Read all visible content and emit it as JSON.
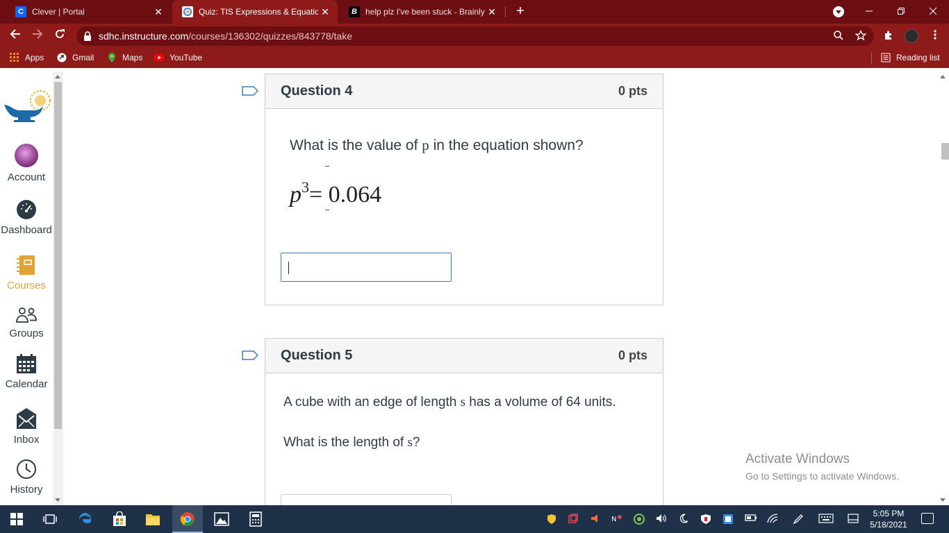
{
  "browser": {
    "tabs": [
      {
        "title": "Clever | Portal",
        "favicon": "clever-icon",
        "active": false
      },
      {
        "title": "Quiz: TIS Expressions & Equations",
        "favicon": "canvas-icon",
        "active": true
      },
      {
        "title": "help plz I've been stuck - Brainly",
        "favicon": "brainly-icon",
        "active": false
      }
    ],
    "close_glyph": "✕",
    "newtab_glyph": "+",
    "url_host": "sdhc.instructure.com",
    "url_path": "/courses/136302/quizzes/843778/take",
    "bookmarks": [
      {
        "label": "Apps",
        "icon": "apps-grid-icon"
      },
      {
        "label": "Gmail",
        "icon": "gmail-icon"
      },
      {
        "label": "Maps",
        "icon": "maps-pin-icon"
      },
      {
        "label": "YouTube",
        "icon": "youtube-icon"
      }
    ],
    "reading_list": "Reading list"
  },
  "global_nav": {
    "items": [
      {
        "label": "Account",
        "icon": "avatar-icon",
        "active": false
      },
      {
        "label": "Dashboard",
        "icon": "dashboard-icon",
        "active": false
      },
      {
        "label": "Courses",
        "icon": "courses-icon",
        "active": true
      },
      {
        "label": "Groups",
        "icon": "groups-icon",
        "active": false
      },
      {
        "label": "Calendar",
        "icon": "calendar-icon",
        "active": false
      },
      {
        "label": "Inbox",
        "icon": "inbox-icon",
        "active": false
      },
      {
        "label": "History",
        "icon": "history-icon",
        "active": false
      }
    ]
  },
  "questions": [
    {
      "title": "Question 4",
      "points": "0 pts",
      "prompt_before": "What is the value of ",
      "prompt_var": "p",
      "prompt_after": " in the equation shown?",
      "equation_var": "p",
      "equation_exp": "3",
      "equation_rhs": "= 0.064",
      "answer_value": ""
    },
    {
      "title": "Question 5",
      "points": "0 pts",
      "line1_before": "A cube with an edge of length ",
      "line1_var": "s",
      "line1_after": " has a volume of 64 units.",
      "line2_before": "What is the length of ",
      "line2_var": "s",
      "line2_after": "?"
    }
  ],
  "watermark": {
    "line1": "Activate Windows",
    "line2": "Go to Settings to activate Windows."
  },
  "taskbar": {
    "time": "5:05 PM",
    "date": "5/18/2021"
  },
  "colors": {
    "chrome_dark": "#6d0f12",
    "chrome_toolbar": "#8f1a1a",
    "nav_active": "#e0a436",
    "text": "#2d3b45",
    "taskbar": "#1f3148"
  }
}
